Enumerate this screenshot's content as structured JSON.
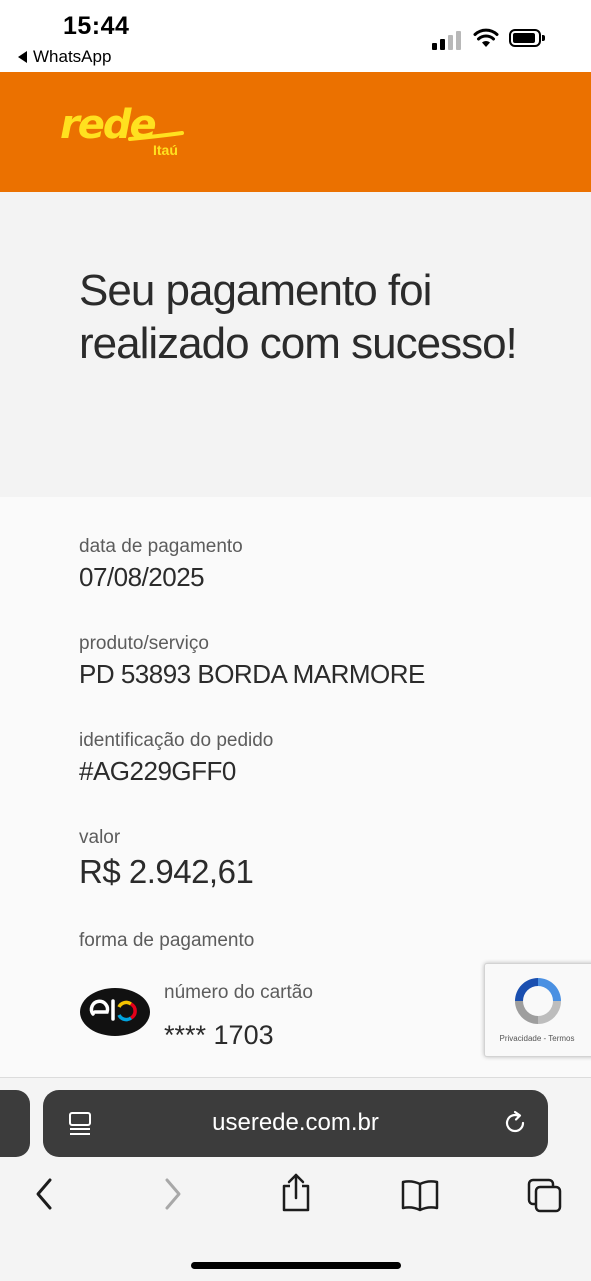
{
  "status_bar": {
    "time": "15:44",
    "back_app": "WhatsApp"
  },
  "header": {
    "logo_text": "rede",
    "logo_subtext": "Itaú",
    "background_color": "#eb7100",
    "logo_color": "#ffe11f"
  },
  "hero": {
    "title": "Seu pagamento foi realizado com sucesso!"
  },
  "details": {
    "payment_date": {
      "label": "data de pagamento",
      "value": "07/08/2025"
    },
    "product": {
      "label": "produto/serviço",
      "value": "PD 53893 BORDA MARMORE"
    },
    "order_id": {
      "label": "identificação do pedido",
      "value": "#AG229GFF0"
    },
    "amount": {
      "label": "valor",
      "value": "R$ 2.942,61"
    },
    "payment_method": {
      "label": "forma de pagamento",
      "card_brand_icon": "elo-card-logo-icon",
      "card_number_label": "número do cartão",
      "card_number": "**** 1703"
    }
  },
  "recaptcha": {
    "links": "Privacidade - Termos"
  },
  "browser": {
    "url": "userede.com.br",
    "icons": [
      "reader-icon",
      "reload-icon",
      "back-icon",
      "forward-icon",
      "share-icon",
      "bookmarks-icon",
      "tabs-icon"
    ]
  }
}
